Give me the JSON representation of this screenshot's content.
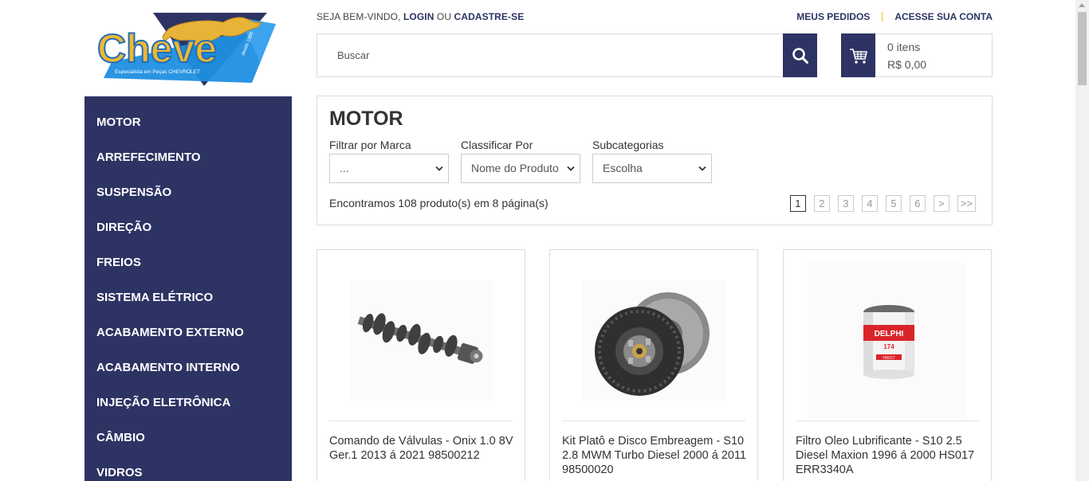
{
  "logo": {
    "brand": "Cheve",
    "tagline": "Especialista em Peças CHEVROLET",
    "year": "desde 1985"
  },
  "header": {
    "welcome_prefix": "SEJA BEM-VINDO,",
    "login": "LOGIN",
    "or": "OU",
    "register": "CADASTRE-SE",
    "my_orders": "MEUS PEDIDOS",
    "account": "ACESSE SUA CONTA"
  },
  "search": {
    "placeholder": "Buscar"
  },
  "cart": {
    "items": "0 itens",
    "total": "R$ 0,00"
  },
  "sidebar": {
    "items": [
      {
        "label": "MOTOR"
      },
      {
        "label": "ARREFECIMENTO"
      },
      {
        "label": "SUSPENSÃO"
      },
      {
        "label": "DIREÇÃO"
      },
      {
        "label": "FREIOS"
      },
      {
        "label": "SISTEMA ELÉTRICO"
      },
      {
        "label": "ACABAMENTO EXTERNO"
      },
      {
        "label": "ACABAMENTO INTERNO"
      },
      {
        "label": "INJEÇÃO ELETRÔNICA"
      },
      {
        "label": "CÂMBIO"
      },
      {
        "label": "VIDROS"
      }
    ]
  },
  "category": {
    "title": "MOTOR",
    "filters": [
      {
        "label": "Filtrar por Marca",
        "value": "..."
      },
      {
        "label": "Classificar Por",
        "value": "Nome do Produto"
      },
      {
        "label": "Subcategorias",
        "value": "Escolha"
      }
    ],
    "found": "Encontramos 108 produto(s) em 8 página(s)",
    "pages": [
      "1",
      "2",
      "3",
      "4",
      "5",
      "6",
      ">",
      ">>"
    ],
    "active_page": "1"
  },
  "products": [
    {
      "name": "Comando de Válvulas - Onix 1.0 8V Ger.1 2013 á 2021 98500212",
      "icon": "camshaft"
    },
    {
      "name": "Kit Platô e Disco Embreagem - S10 2.8 MWM Turbo Diesel 2000 á 2011 98500020",
      "icon": "clutch-kit"
    },
    {
      "name": "Filtro Oleo Lubrificante - S10 2.5 Diesel Maxion 1996 á 2000 HS017 ERR3340A",
      "icon": "oil-filter",
      "filter_brand": "DELPHI",
      "filter_code": "174",
      "filter_ref": "HS017"
    }
  ],
  "colors": {
    "brand_navy": "#2d3363",
    "accent_yellow": "#f0c419",
    "logo_blue": "#1f8fe0"
  }
}
